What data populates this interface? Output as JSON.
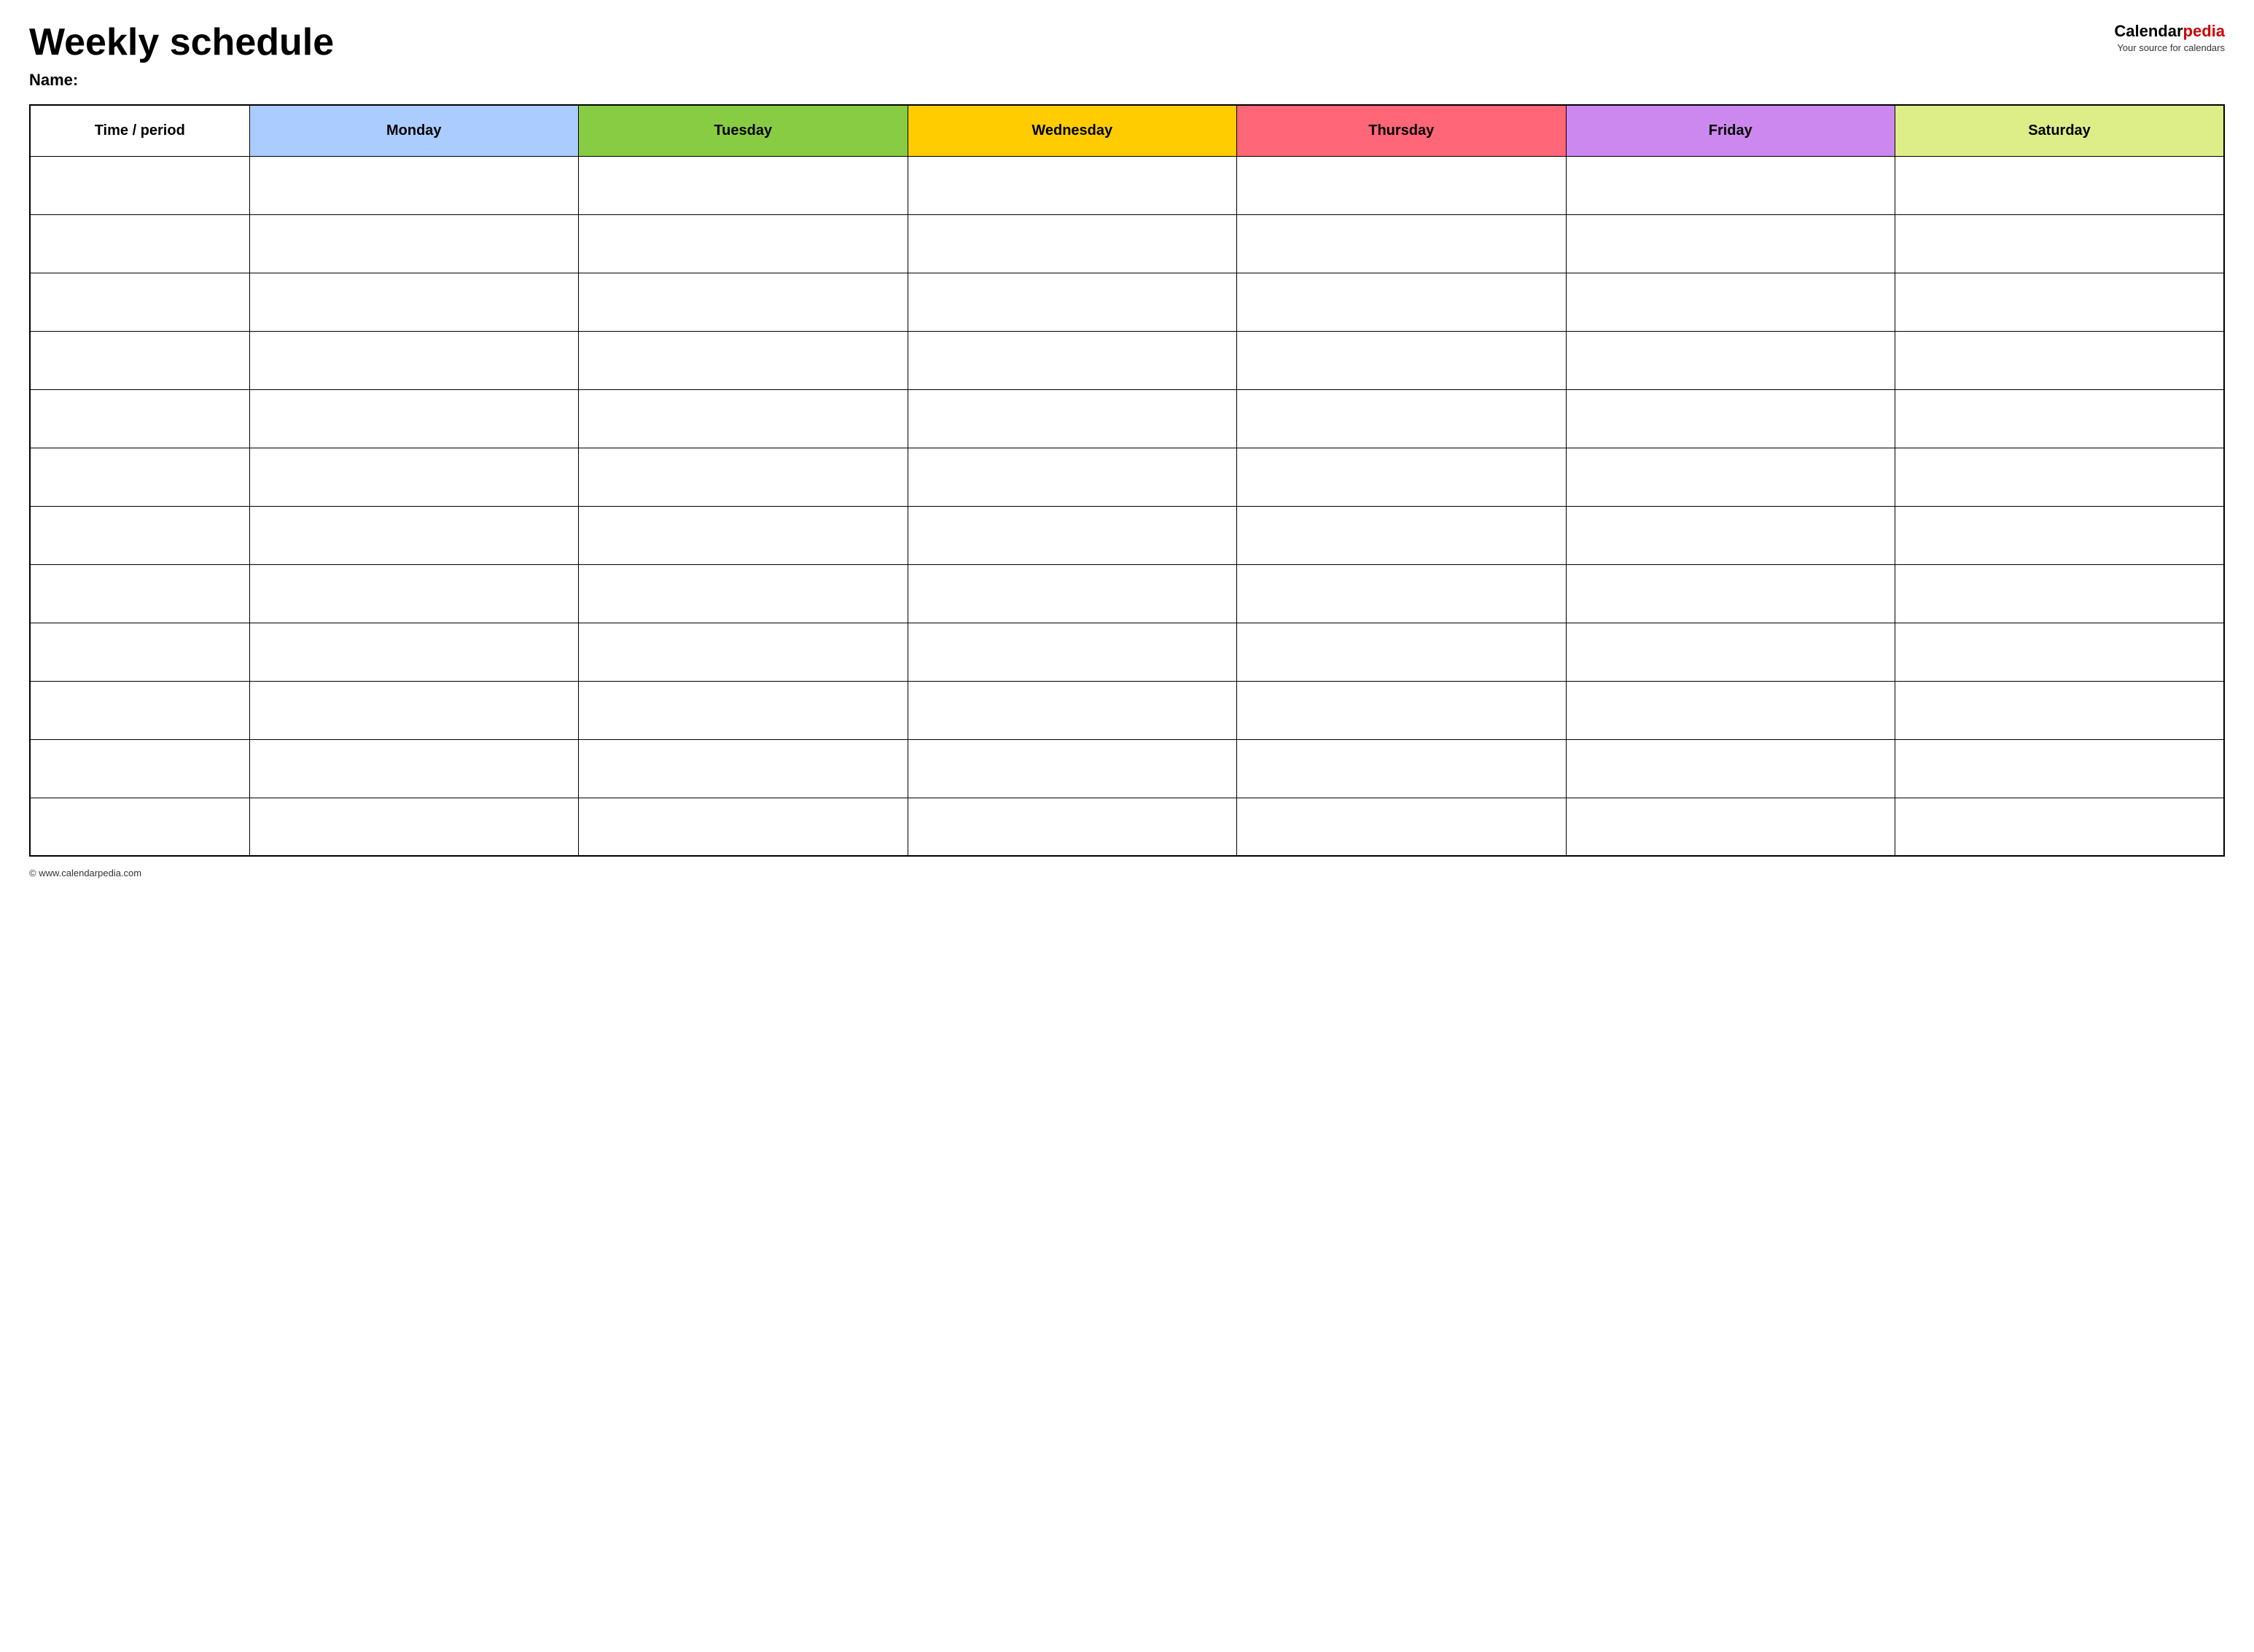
{
  "header": {
    "title": "Weekly schedule",
    "name_label": "Name:",
    "logo": {
      "calendar": "Calendar",
      "pedia": "pedia",
      "subtitle": "Your source for calendars"
    }
  },
  "table": {
    "columns": [
      {
        "id": "time",
        "label": "Time / period",
        "color": "#ffffff"
      },
      {
        "id": "monday",
        "label": "Monday",
        "color": "#aaccff"
      },
      {
        "id": "tuesday",
        "label": "Tuesday",
        "color": "#88cc44"
      },
      {
        "id": "wednesday",
        "label": "Wednesday",
        "color": "#ffcc00"
      },
      {
        "id": "thursday",
        "label": "Thursday",
        "color": "#ff6677"
      },
      {
        "id": "friday",
        "label": "Friday",
        "color": "#cc88ee"
      },
      {
        "id": "saturday",
        "label": "Saturday",
        "color": "#ddee88"
      }
    ],
    "row_count": 12
  },
  "footer": {
    "url": "© www.calendarpedia.com"
  }
}
